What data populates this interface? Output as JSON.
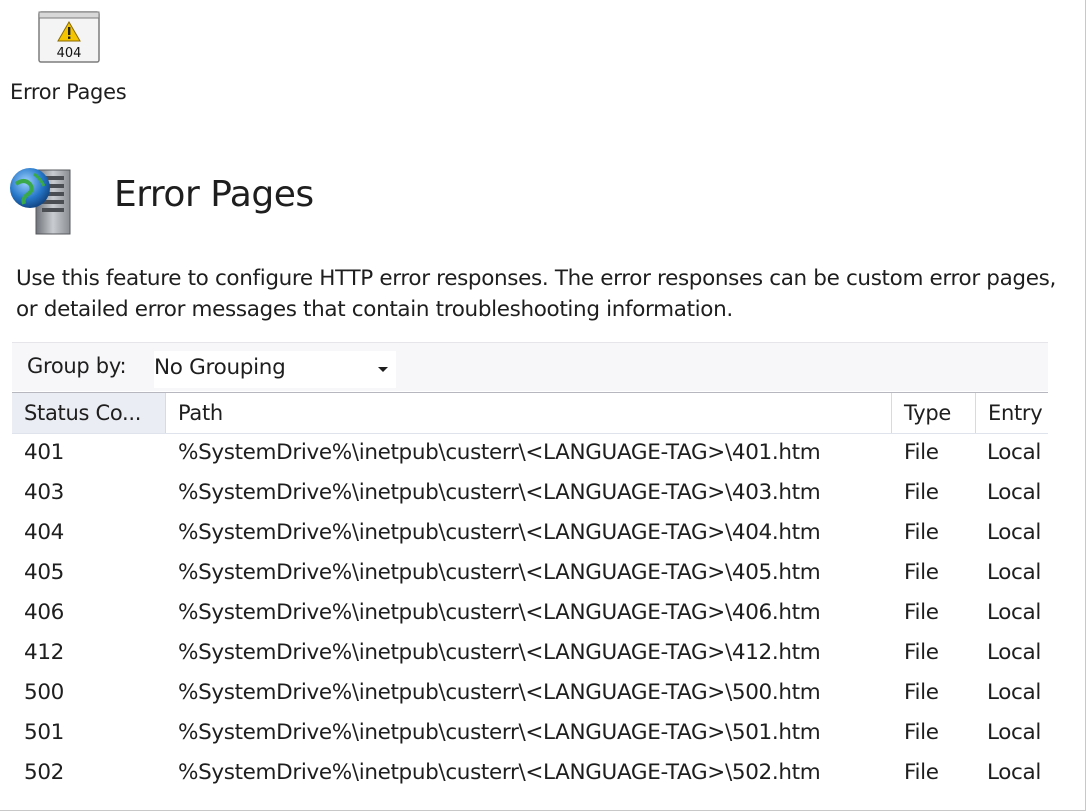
{
  "feature_tile": {
    "icon": "error-page-404-icon",
    "icon_text": "404",
    "label": "Error Pages"
  },
  "header": {
    "icon": "globe-server-icon",
    "title": "Error Pages",
    "description": "Use this feature to configure HTTP error responses. The error responses can be custom error pages, or detailed error messages that contain troubleshooting information."
  },
  "group_by": {
    "label": "Group by:",
    "selected": "No Grouping"
  },
  "grid": {
    "columns": [
      "Status Co...",
      "Path",
      "Type",
      "Entry"
    ],
    "rows": [
      {
        "status": "401",
        "path": "%SystemDrive%\\inetpub\\custerr\\<LANGUAGE-TAG>\\401.htm",
        "type": "File",
        "entry": "Local"
      },
      {
        "status": "403",
        "path": "%SystemDrive%\\inetpub\\custerr\\<LANGUAGE-TAG>\\403.htm",
        "type": "File",
        "entry": "Local"
      },
      {
        "status": "404",
        "path": "%SystemDrive%\\inetpub\\custerr\\<LANGUAGE-TAG>\\404.htm",
        "type": "File",
        "entry": "Local"
      },
      {
        "status": "405",
        "path": "%SystemDrive%\\inetpub\\custerr\\<LANGUAGE-TAG>\\405.htm",
        "type": "File",
        "entry": "Local"
      },
      {
        "status": "406",
        "path": "%SystemDrive%\\inetpub\\custerr\\<LANGUAGE-TAG>\\406.htm",
        "type": "File",
        "entry": "Local"
      },
      {
        "status": "412",
        "path": "%SystemDrive%\\inetpub\\custerr\\<LANGUAGE-TAG>\\412.htm",
        "type": "File",
        "entry": "Local"
      },
      {
        "status": "500",
        "path": "%SystemDrive%\\inetpub\\custerr\\<LANGUAGE-TAG>\\500.htm",
        "type": "File",
        "entry": "Local"
      },
      {
        "status": "501",
        "path": "%SystemDrive%\\inetpub\\custerr\\<LANGUAGE-TAG>\\501.htm",
        "type": "File",
        "entry": "Local"
      },
      {
        "status": "502",
        "path": "%SystemDrive%\\inetpub\\custerr\\<LANGUAGE-TAG>\\502.htm",
        "type": "File",
        "entry": "Local"
      }
    ]
  },
  "colors": {
    "toolbar_bg": "#f7f6f9",
    "sorted_column_bg": "#eaedf3",
    "warning_yellow": "#f5c400"
  }
}
